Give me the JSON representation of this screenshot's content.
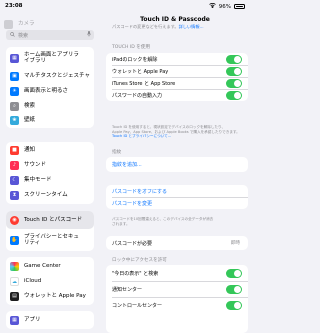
{
  "status_bar": {
    "time": "23:08",
    "battery": "96%"
  },
  "sidebar": {
    "search_placeholder": "検索",
    "partial_top": "カメラ",
    "groups": [
      {
        "items": [
          {
            "label": "ホーム画面とアプリライブラリ",
            "color": "#5856d6",
            "icon": "home-screen-icon"
          },
          {
            "label": "マルチタスクとジェスチャ",
            "color": "#007aff",
            "icon": "multitasking-icon"
          },
          {
            "label": "画面表示と明るさ",
            "color": "#007aff",
            "icon": "display-icon"
          },
          {
            "label": "検索",
            "color": "#8e8e93",
            "icon": "search-icon"
          },
          {
            "label": "壁紙",
            "color": "#34aadc",
            "icon": "wallpaper-icon"
          }
        ]
      },
      {
        "items": [
          {
            "label": "通知",
            "color": "#ff3b30",
            "icon": "notifications-icon"
          },
          {
            "label": "サウンド",
            "color": "#ff2d55",
            "icon": "sounds-icon"
          },
          {
            "label": "集中モード",
            "color": "#5856d6",
            "icon": "focus-icon"
          },
          {
            "label": "スクリーンタイム",
            "color": "#5856d6",
            "icon": "screen-time-icon"
          }
        ]
      },
      {
        "items": [
          {
            "label": "Touch ID とパスコード",
            "color": "#ff3b30",
            "icon": "touch-id-icon",
            "selected": true
          },
          {
            "label": "プライバシーとセキュリティ",
            "color": "#007aff",
            "icon": "privacy-icon"
          }
        ]
      },
      {
        "items": [
          {
            "label": "Game Center",
            "color": "#ffffff",
            "icon": "game-center-icon"
          },
          {
            "label": "iCloud",
            "color": "#ffffff",
            "icon": "icloud-icon"
          },
          {
            "label": "ウォレットと Apple Pay",
            "color": "#1c1c1e",
            "icon": "wallet-icon"
          }
        ]
      },
      {
        "items": [
          {
            "label": "アプリ",
            "color": "#5856d6",
            "icon": "apps-icon"
          }
        ]
      }
    ]
  },
  "main": {
    "title": "Touch ID & Passcode",
    "intro_text": "パスコードの変更などを行えます。",
    "intro_link": "詳しい情報...",
    "section_use": "TOUCH ID を使用",
    "use_items": [
      {
        "label": "iPadのロックを解除"
      },
      {
        "label": "ウォレットと Apple Pay"
      },
      {
        "label": "iTunes Store と App Store"
      },
      {
        "label": "パスワードの自動入力"
      }
    ],
    "use_note_line1": "Touch ID を使用すると、現状設定でデバイスのロックを解除したり、",
    "use_note_line2": "Apple Pay、App Store、および Apple Books で購入を承認したりできます。",
    "use_note_link": "Touch ID とプライバシーについて...",
    "section_fingerprints": "指紋",
    "add_fingerprint": "指紋を追加...",
    "passcode_off": "パスコードをオフにする",
    "change_passcode": "パスコードを変更",
    "erase_note_line1": "パスコードを10回間違えると、このデバイスの全データが消去",
    "erase_note_line2": "されます。",
    "require_passcode": {
      "label": "パスコードが必要",
      "value": "即時"
    },
    "section_locked": "ロック中にアクセスを許可",
    "locked_items": [
      {
        "label": "\"今日の表示\" と検索"
      },
      {
        "label": "通知センター"
      },
      {
        "label": "コントロールセンター"
      }
    ]
  }
}
